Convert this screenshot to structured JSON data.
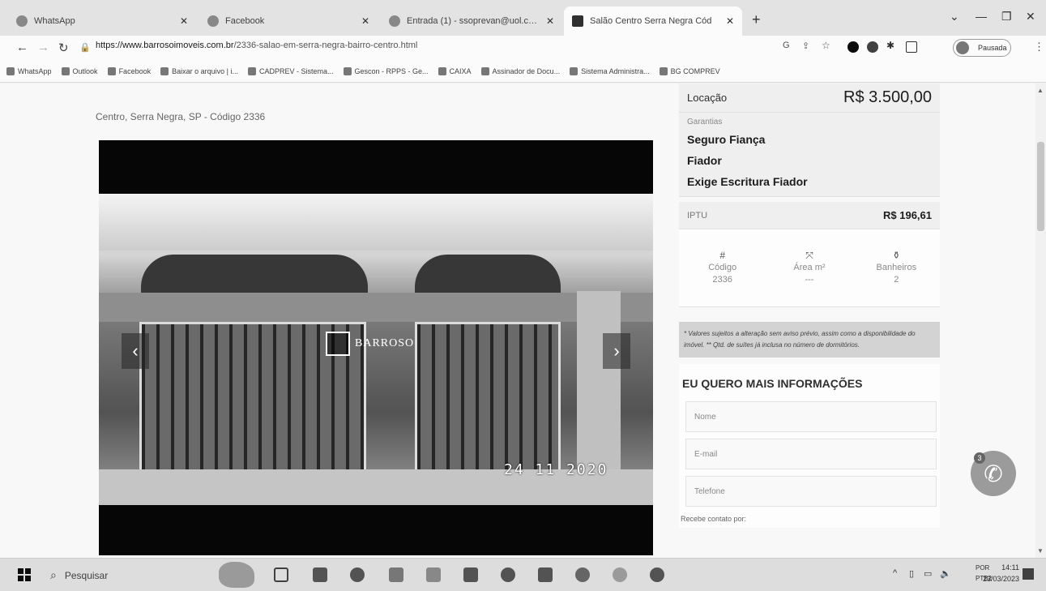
{
  "browser": {
    "tabs": [
      {
        "title": "WhatsApp"
      },
      {
        "title": "Facebook"
      },
      {
        "title": "Entrada (1) - ssoprevan@uol.com"
      },
      {
        "title": "Salão Centro Serra Negra Cód"
      }
    ],
    "new_tab": "+",
    "url_host": "https://www.barrosoimoveis.com.br",
    "url_path": "/2336-salao-em-serra-negra-bairro-centro.html",
    "profile_status": "Pausada",
    "bookmarks": [
      "WhatsApp",
      "Outlook",
      "Facebook",
      "Baixar o arquivo | i...",
      "CADPREV - Sistema...",
      "Gescon - RPPS - Ge...",
      "CAIXA",
      "Assinador de Docu...",
      "Sistema Administra...",
      "BG COMPREV"
    ]
  },
  "listing": {
    "location": "Centro, Serra Negra, SP - Código 2336",
    "gallery": {
      "watermark": "BARROSO",
      "date_stamp": "24 11 2020",
      "prev": "‹",
      "next": "›"
    },
    "rent_label": "Locação",
    "rent_value": "R$ 3.500,00",
    "guarantees_label": "Garantias",
    "guarantees": [
      "Seguro Fiança",
      "Fiador",
      "Exige Escritura Fiador"
    ],
    "iptu_label": "IPTU",
    "iptu_value": "R$ 196,61",
    "stats": [
      {
        "icon": "#",
        "label": "Código",
        "value": "2336"
      },
      {
        "icon": "⤧",
        "label": "Área m²",
        "value": "---"
      },
      {
        "icon": "⚱",
        "label": "Banheiros",
        "value": "2"
      }
    ],
    "disclaimer": "* Valores sujeitos a alteração sem aviso prévio, assim como a disponibilidade do imóvel. ** Qtd. de suítes já inclusa no número de dormitórios."
  },
  "contact_form": {
    "title": "EU QUERO MAIS INFORMAÇÕES",
    "name_placeholder": "Nome",
    "email_placeholder": "E-mail",
    "phone_placeholder": "Telefone",
    "receive_label": "Recebe contato por:"
  },
  "whatsapp_badge": "3",
  "taskbar": {
    "search_placeholder": "Pesquisar",
    "lang_top": "POR",
    "lang_bottom": "PTB2",
    "time": "14:11",
    "date": "23/03/2023"
  }
}
